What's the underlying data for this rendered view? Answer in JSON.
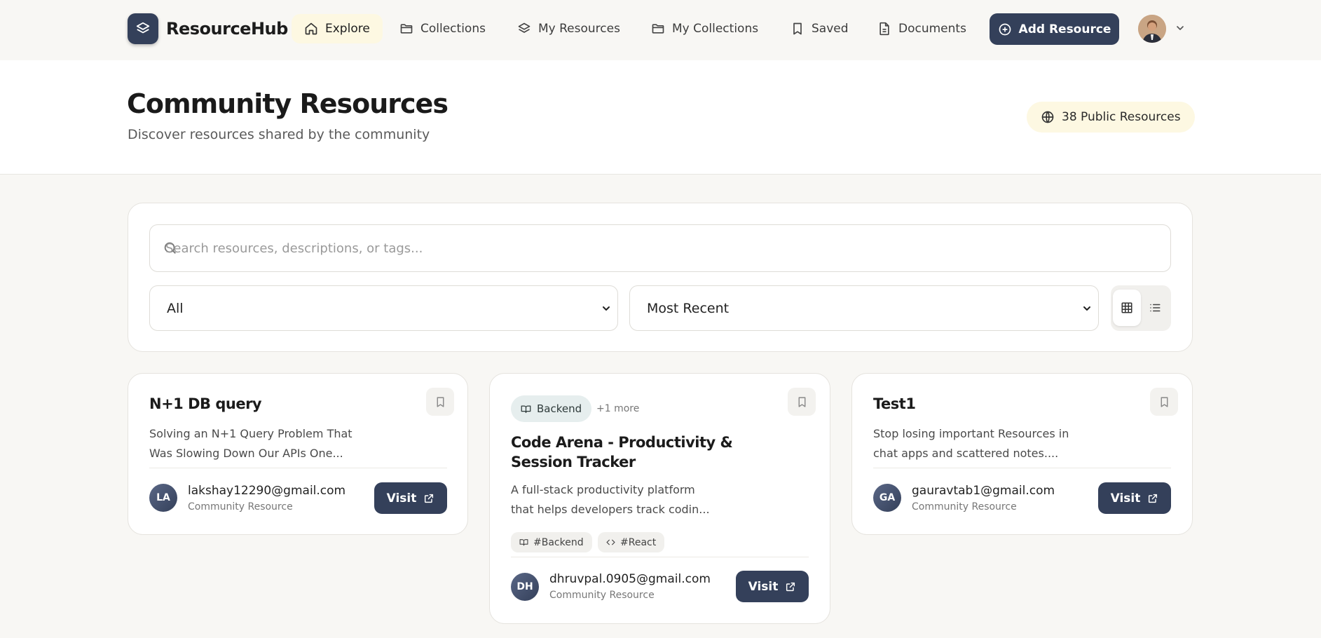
{
  "brand": {
    "name": "ResourceHub"
  },
  "nav": {
    "items": [
      {
        "label": "Explore",
        "icon": "home-icon",
        "active": true
      },
      {
        "label": "Collections",
        "icon": "folder-icon"
      },
      {
        "label": "My Resources",
        "icon": "layers-icon"
      },
      {
        "label": "My Collections",
        "icon": "folder-icon"
      },
      {
        "label": "Saved",
        "icon": "bookmark-icon"
      },
      {
        "label": "Documents",
        "icon": "document-icon"
      }
    ],
    "add_button": "Add Resource"
  },
  "header": {
    "title": "Community Resources",
    "subtitle": "Discover resources shared by the community",
    "badge": "38 Public Resources"
  },
  "filters": {
    "search_placeholder": "Search resources, descriptions, or tags...",
    "category_selected": "All",
    "sort_selected": "Most Recent",
    "view_mode": "grid"
  },
  "resources": [
    {
      "title": "N+1 DB query",
      "description_lines": [
        "Solving an N+1 Query Problem That",
        "Was Slowing Down Our APIs One..."
      ],
      "author_initials": "LA",
      "author": "lakshay12290@gmail.com",
      "author_sub": "Community Resource",
      "visit_label": "Visit"
    },
    {
      "category": "Backend",
      "more": "+1 more",
      "title_lines": [
        "Code Arena - Productivity &",
        "Session Tracker"
      ],
      "description_lines": [
        "A full-stack productivity platform",
        "that helps developers track codin..."
      ],
      "tags": [
        "#Backend",
        "#React"
      ],
      "author_initials": "DH",
      "author": "dhruvpal.0905@gmail.com",
      "author_sub": "Community Resource",
      "visit_label": "Visit"
    },
    {
      "title": "Test1",
      "description_lines": [
        "Stop losing important Resources in",
        "chat apps and scattered notes...."
      ],
      "author_initials": "GA",
      "author": "gauravtab1@gmail.com",
      "author_sub": "Community Resource",
      "visit_label": "Visit"
    }
  ],
  "colors": {
    "primary": "#34405a",
    "highlight": "#fdf8e2",
    "background": "#f8f7f4"
  }
}
